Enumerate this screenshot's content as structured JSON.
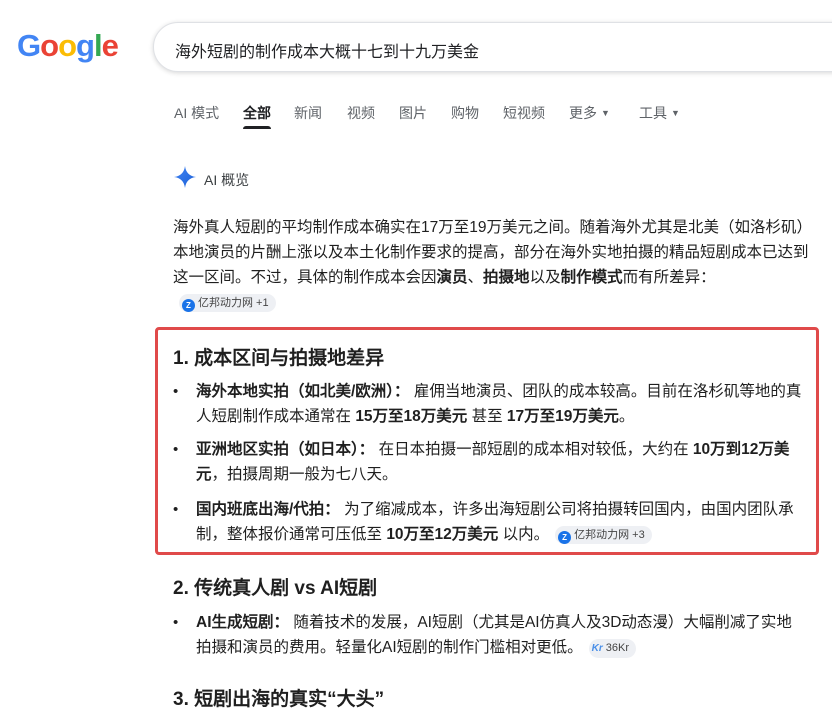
{
  "logo": {
    "letters": [
      "G",
      "o",
      "o",
      "g",
      "l",
      "e"
    ],
    "colors": [
      "#4285f4",
      "#ea4335",
      "#fbbc05",
      "#4285f4",
      "#34a853",
      "#ea4335"
    ]
  },
  "search": {
    "query": "海外短剧的制作成本大概十七到十九万美金"
  },
  "tabs": [
    {
      "label": "AI 模式"
    },
    {
      "label": "全部",
      "active": true
    },
    {
      "label": "新闻"
    },
    {
      "label": "视频"
    },
    {
      "label": "图片"
    },
    {
      "label": "购物"
    },
    {
      "label": "短视频"
    },
    {
      "label": "更多"
    },
    {
      "label": "工具"
    }
  ],
  "ai_overview": {
    "label": "AI 概览",
    "icon": "sparkle-icon"
  },
  "intro": {
    "t1": "海外真人短剧的平均制作成本确实在17万至19万美元之间。随着海外尤其是北美（如洛杉矶）本地演员的片酬上涨以及本土化制作要求的提高，部分在海外实地拍摄的精品短剧成本已达到这一区间。不过，具体的制作成本会因",
    "b1": "演员",
    "t2": "、",
    "b2": "拍摄地",
    "t3": "以及",
    "b3": "制作模式",
    "t4": "而有所差异：",
    "chip": "亿邦动力网 +1"
  },
  "section1": {
    "title": "1. 成本区间与拍摄地差异",
    "items": [
      {
        "head": "海外本地实拍（如北美/欧洲）：",
        "t1": " 雇佣当地演员、团队的成本较高。目前在洛杉矶等地的真人短剧制作成本通常在 ",
        "b1": "15万至18万美元",
        "t2": " 甚至 ",
        "b2": "17万至19万美元",
        "t3": "。"
      },
      {
        "head": "亚洲地区实拍（如日本）：",
        "t1": " 在日本拍摄一部短剧的成本相对较低，大约在 ",
        "b1": "10万到12万美元",
        "t2": "，拍摄周期一般为七八天。"
      },
      {
        "head": "国内班底出海/代拍：",
        "t1": " 为了缩减成本，许多出海短剧公司将拍摄转回国内，由国内团队承制，整体报价通常可压低至 ",
        "b1": "10万至12万美元",
        "t2": " 以内。",
        "chip": "亿邦动力网 +3"
      }
    ]
  },
  "section2": {
    "title": "2. 传统真人剧 vs AI短剧",
    "items": [
      {
        "head": "AI生成短剧：",
        "t1": " 随着技术的发展，AI短剧（尤其是AI仿真人及3D动态漫）大幅削减了实地拍摄和演员的费用。轻量化AI短剧的制作门槛相对更低。",
        "chip": "36Kr",
        "chip_icon": "Kr"
      }
    ]
  },
  "section3": {
    "title": "3. 短剧出海的真实“大头”"
  }
}
